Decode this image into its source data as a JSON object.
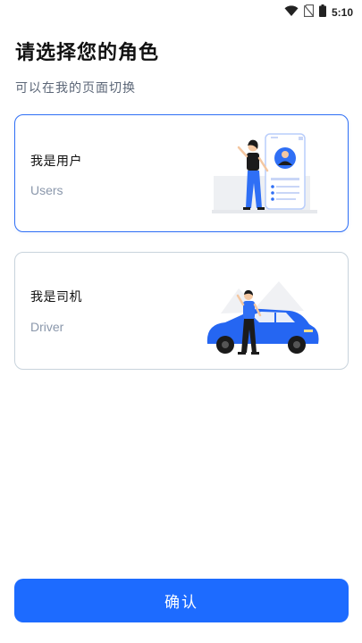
{
  "status_bar": {
    "time": "5:10",
    "icons": [
      "wifi-icon",
      "no-sim-icon",
      "battery-icon"
    ]
  },
  "header": {
    "title": "请选择您的角色",
    "subtitle": "可以在我的页面切换"
  },
  "roles": [
    {
      "name": "我是用户",
      "en": "Users",
      "selected": true,
      "illustration": "user-with-phone-illustration"
    },
    {
      "name": "我是司机",
      "en": "Driver",
      "selected": false,
      "illustration": "driver-with-car-illustration"
    }
  ],
  "footer": {
    "confirm_label": "确认"
  },
  "colors": {
    "accent": "#1d6bff",
    "selected_border": "#2f6ff5",
    "unselected_border": "#c8d3dc",
    "subtext": "#8a97ab"
  }
}
